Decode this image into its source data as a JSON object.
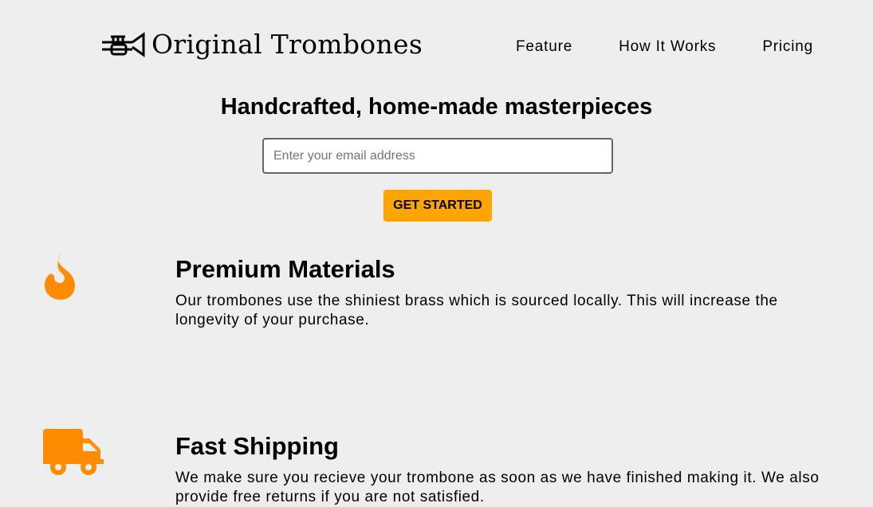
{
  "header": {
    "brand": "Original Trombones",
    "nav": [
      "Feature",
      "How It Works",
      "Pricing"
    ]
  },
  "hero": {
    "title": "Handcrafted, home-made masterpieces",
    "email_placeholder": "Enter your email address",
    "email_value": "",
    "cta": "GET STARTED"
  },
  "features": [
    {
      "icon": "fire-icon",
      "title": "Premium Materials",
      "description": "Our trombones use the shiniest brass which is sourced locally. This will increase the longevity of your purchase."
    },
    {
      "icon": "truck-icon",
      "title": "Fast Shipping",
      "description": "We make sure you recieve your trombone as soon as we have finished making it. We also provide free returns if you are not satisfied."
    }
  ],
  "colors": {
    "accent": "#ff8c00",
    "button": "#ffa500",
    "background": "#eeeeee"
  }
}
